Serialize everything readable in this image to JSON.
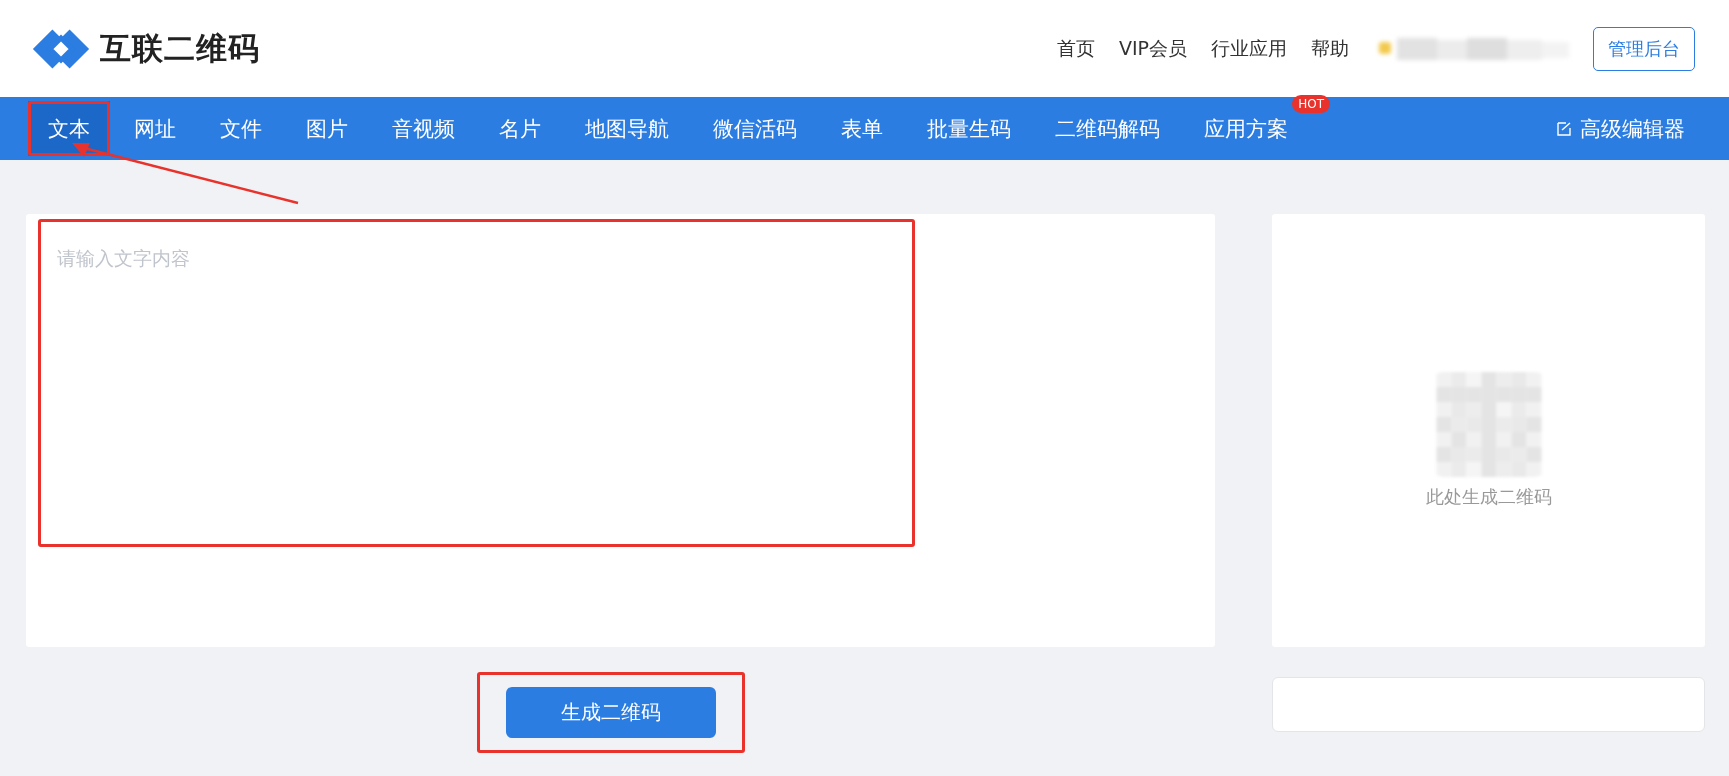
{
  "brand": {
    "name": "互联二维码"
  },
  "top_links": [
    {
      "label": "首页"
    },
    {
      "label": "VIP会员"
    },
    {
      "label": "行业应用"
    },
    {
      "label": "帮助"
    }
  ],
  "admin_button": "管理后台",
  "tabs": [
    {
      "label": "文本",
      "selected": true,
      "highlighted": true,
      "arrow": true
    },
    {
      "label": "网址",
      "selected": false
    },
    {
      "label": "文件",
      "selected": false
    },
    {
      "label": "图片",
      "selected": false
    },
    {
      "label": "音视频",
      "selected": false
    },
    {
      "label": "名片",
      "selected": false
    },
    {
      "label": "地图导航",
      "selected": false
    },
    {
      "label": "微信活码",
      "selected": false
    },
    {
      "label": "表单",
      "selected": false
    },
    {
      "label": "批量生码",
      "selected": false
    },
    {
      "label": "二维码解码",
      "selected": false
    },
    {
      "label": "应用方案",
      "selected": false,
      "badge": "HOT"
    }
  ],
  "editor_link": "高级编辑器",
  "text_input": {
    "placeholder": "请输入文字内容",
    "highlighted": true
  },
  "generate_button": {
    "label": "生成二维码",
    "highlighted": true
  },
  "preview": {
    "caption": "此处生成二维码"
  }
}
